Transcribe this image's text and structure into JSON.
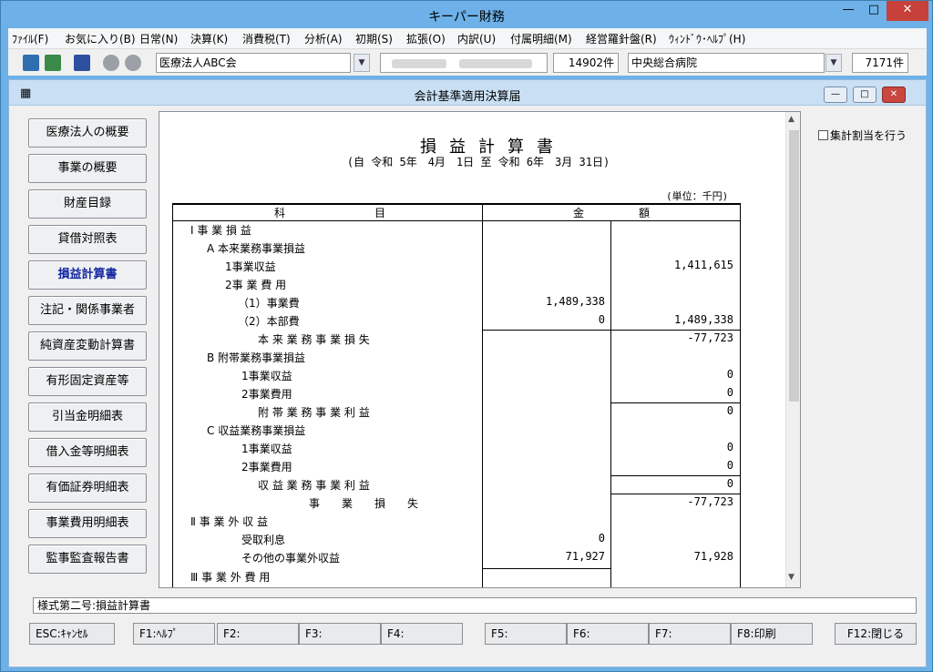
{
  "window": {
    "title": "キーパー財務",
    "controls": {
      "minimize": "—",
      "maximize": "□",
      "close": "✕"
    }
  },
  "menu": [
    "ﾌｧｲﾙ(F)",
    "お気に入り(B)",
    "日常(N)",
    "決算(K)",
    "消費税(T)",
    "分析(A)",
    "初期(S)",
    "拡張(O)",
    "内訳(U)",
    "付属明細(M)",
    "経営羅針盤(R)",
    "ｳｨﾝﾄﾞｳ･ﾍﾙﾌﾟ(H)"
  ],
  "toolbar": {
    "corporation": "医療法人ABC会",
    "count1": "14902件",
    "hospital": "中央総合病院",
    "count2": "7171件",
    "dropdown_glyph": "▼"
  },
  "child_window": {
    "title": "会計基準適用決算届",
    "icon": "▦",
    "controls": {
      "minimize": "—",
      "restore": "□",
      "close": "✕"
    }
  },
  "sidebar": {
    "items": [
      "医療法人の概要",
      "事業の概要",
      "財産目録",
      "貸借対照表",
      "損益計算書",
      "注記・関係事業者",
      "純資産変動計算書",
      "有形固定資産等",
      "引当金明細表",
      "借入金等明細表",
      "有価証券明細表",
      "事業費用明細表",
      "監事監査報告書"
    ],
    "active": "損益計算書"
  },
  "document": {
    "title": "損益計算書",
    "period": "(自 令和 5年　4月　1日 至 令和 6年　3月 31日)",
    "unit": "(単位：千円)",
    "col_subject_1": "科",
    "col_subject_2": "目",
    "col_amount_1": "金",
    "col_amount_2": "額",
    "rows": [
      {
        "label": "Ⅰ 事 業 損 益",
        "mid": "",
        "right": ""
      },
      {
        "label": "A 本来業務事業損益",
        "mid": "",
        "right": ""
      },
      {
        "label": "1事業収益",
        "mid": "",
        "right": "1,411,615"
      },
      {
        "label": "2事 業 費 用",
        "mid": "",
        "right": ""
      },
      {
        "label": "（1）事業費",
        "mid": "1,489,338",
        "right": ""
      },
      {
        "label": "（2）本部費",
        "mid": "0",
        "right": "1,489,338"
      },
      {
        "label": "本 来 業 務 事 業 損 失",
        "mid": "",
        "right": "-77,723"
      },
      {
        "label": "B 附帯業務事業損益",
        "mid": "",
        "right": ""
      },
      {
        "label": "1事業収益",
        "mid": "",
        "right": "0"
      },
      {
        "label": "2事業費用",
        "mid": "",
        "right": "0"
      },
      {
        "label": "附 帯 業 務 事 業 利 益",
        "mid": "",
        "right": "0"
      },
      {
        "label": "C 収益業務事業損益",
        "mid": "",
        "right": ""
      },
      {
        "label": "1事業収益",
        "mid": "",
        "right": "0"
      },
      {
        "label": "2事業費用",
        "mid": "",
        "right": "0"
      },
      {
        "label": "収 益 業 務 事 業 利 益",
        "mid": "",
        "right": "0"
      },
      {
        "label": "事　　業　　損　　失",
        "mid": "",
        "right": "-77,723"
      },
      {
        "label": "Ⅱ 事 業 外 収 益",
        "mid": "",
        "right": ""
      },
      {
        "label": "受取利息",
        "mid": "0",
        "right": ""
      },
      {
        "label": "その他の事業外収益",
        "mid": "71,927",
        "right": "71,928"
      },
      {
        "label": "Ⅲ 事 業 外 費 用",
        "mid": "",
        "right": ""
      }
    ]
  },
  "right_panel": {
    "checkbox_label": "集計割当を行う",
    "checked": false
  },
  "status": "様式第二号:損益計算書",
  "fkeys": [
    "ESC:ｷｬﾝｾﾙ",
    "F1:ﾍﾙﾌﾟ",
    "F2:",
    "F3:",
    "F4:",
    "F5:",
    "F6:",
    "F7:",
    "F8:印刷",
    "F12:閉じる"
  ]
}
